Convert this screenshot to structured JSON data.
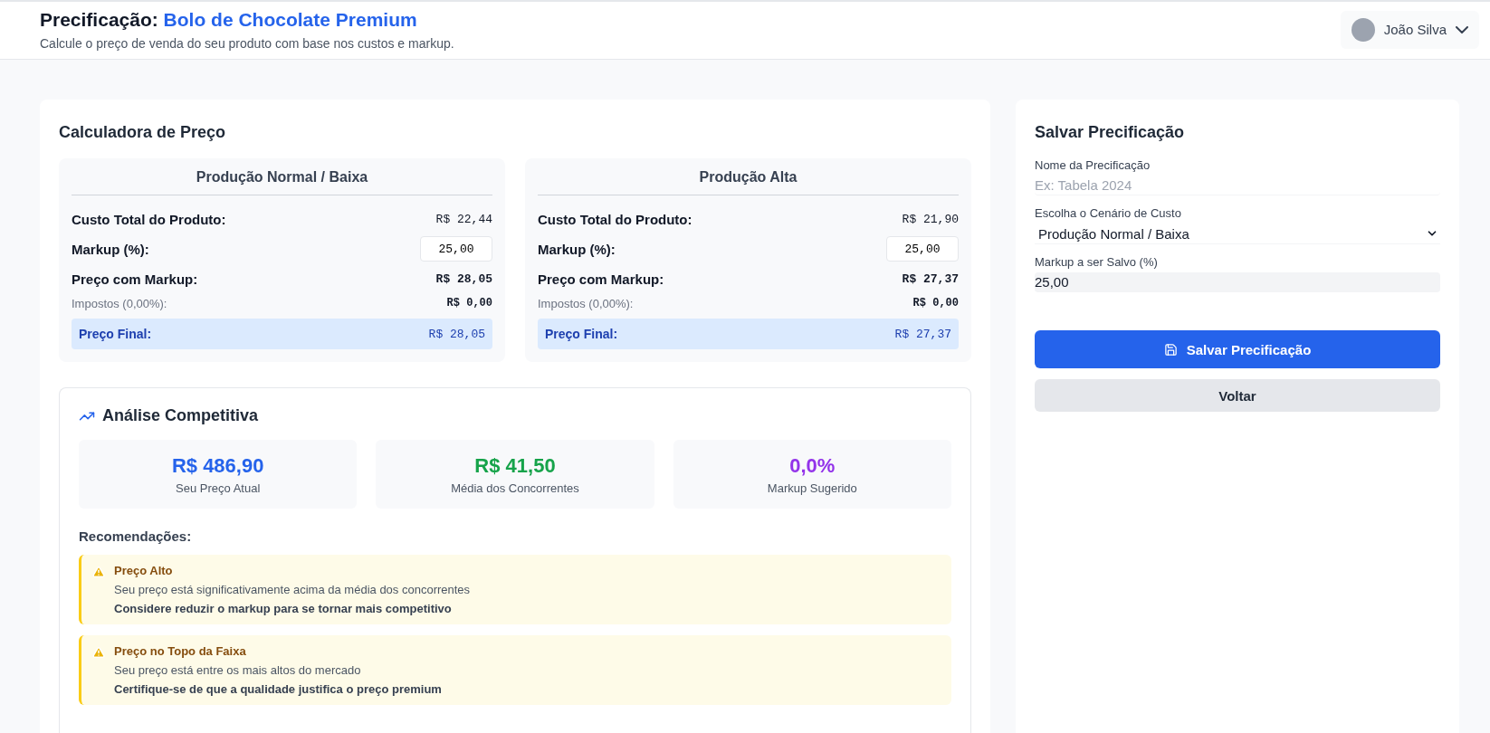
{
  "header": {
    "title_prefix": "Precificação:",
    "product": "Bolo de Chocolate Premium",
    "subtitle": "Calcule o preço de venda do seu produto com base nos custos e markup.",
    "user": {
      "name": "João Silva"
    }
  },
  "calculator": {
    "title": "Calculadora de Preço",
    "scenarios": [
      {
        "title": "Produção Normal / Baixa",
        "cost_label": "Custo Total do Produto:",
        "cost": "R$ 22,44",
        "markup_label": "Markup (%):",
        "markup": "25,00",
        "price_label": "Preço com Markup:",
        "price": "R$ 28,05",
        "tax_label": "Impostos (0,00%):",
        "tax": "R$ 0,00",
        "final_label": "Preço Final:",
        "final": "R$ 28,05"
      },
      {
        "title": "Produção Alta",
        "cost_label": "Custo Total do Produto:",
        "cost": "R$ 21,90",
        "markup_label": "Markup (%):",
        "markup": "25,00",
        "price_label": "Preço com Markup:",
        "price": "R$ 27,37",
        "tax_label": "Impostos (0,00%):",
        "tax": "R$ 0,00",
        "final_label": "Preço Final:",
        "final": "R$ 27,37"
      }
    ]
  },
  "analysis": {
    "title": "Análise Competitiva",
    "stats": [
      {
        "value": "R$ 486,90",
        "label": "Seu Preço Atual",
        "color": "#2563eb"
      },
      {
        "value": "R$ 41,50",
        "label": "Média dos Concorrentes",
        "color": "#16a34a"
      },
      {
        "value": "0,0%",
        "label": "Markup Sugerido",
        "color": "#9333ea"
      }
    ],
    "recommendations_title": "Recomendações:",
    "recommendations": [
      {
        "title": "Preço Alto",
        "message": "Seu preço está significativamente acima da média dos concorrentes",
        "action": "Considere reduzir o markup para se tornar mais competitivo"
      },
      {
        "title": "Preço no Topo da Faixa",
        "message": "Seu preço está entre os mais altos do mercado",
        "action": "Certifique-se de que a qualidade justifica o preço premium"
      }
    ]
  },
  "save_panel": {
    "title": "Salvar Precificação",
    "name_label": "Nome da Precificação",
    "name_placeholder": "Ex: Tabela 2024",
    "scenario_label": "Escolha o Cenário de Custo",
    "scenario_value": "Produção Normal / Baixa",
    "markup_label": "Markup a ser Salvo (%)",
    "markup_value": "25,00",
    "save_button": "Salvar Precificação",
    "back_button": "Voltar"
  }
}
